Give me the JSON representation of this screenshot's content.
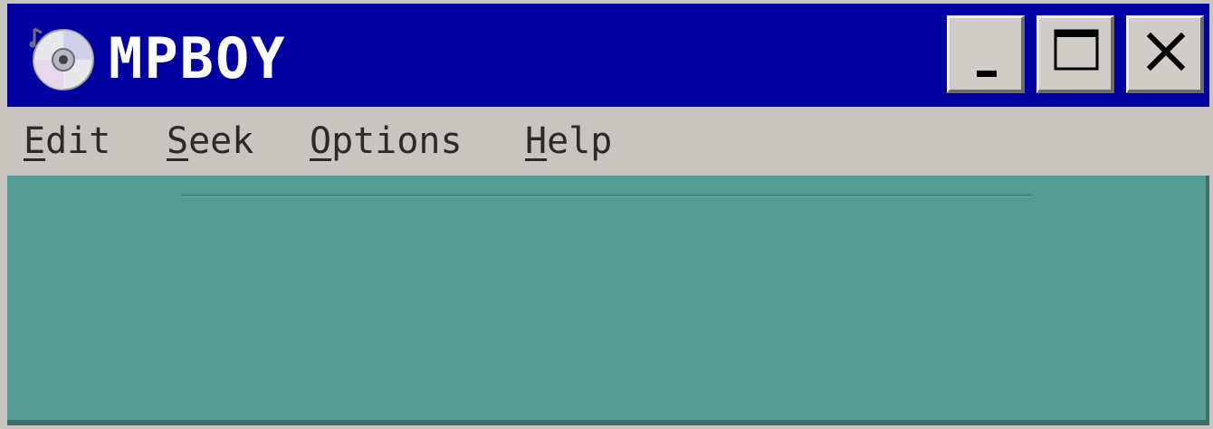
{
  "window": {
    "title": "MPBOY",
    "icon": "cd-disc-icon",
    "colors": {
      "titlebar": "#0000a0",
      "title_text": "#ffffff",
      "menubar": "#c8c4c0",
      "client_area": "#559c94"
    }
  },
  "controls": {
    "minimize_icon": "minimize-icon",
    "maximize_icon": "maximize-icon",
    "close_icon": "close-icon"
  },
  "menu": {
    "items": [
      {
        "accel": "E",
        "rest": "dit"
      },
      {
        "accel": "S",
        "rest": "eek"
      },
      {
        "accel": "O",
        "rest": "ptions"
      },
      {
        "accel": "H",
        "rest": "elp"
      }
    ]
  }
}
